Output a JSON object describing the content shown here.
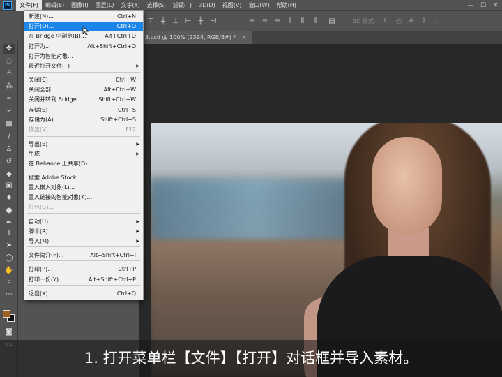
{
  "app": {
    "logo_text": "Ps"
  },
  "menubar": {
    "items": [
      "文件(F)",
      "编辑(E)",
      "图像(I)",
      "图层(L)",
      "文字(Y)",
      "选择(S)",
      "滤镜(T)",
      "3D(D)",
      "视图(V)",
      "窗口(W)",
      "帮助(H)"
    ],
    "active_index": 0,
    "window_controls": [
      "—",
      "☐",
      "✕"
    ]
  },
  "options_bar": {
    "mode_label": "3D 模式:"
  },
  "document": {
    "tab_title": "3.psd @ 100% (2394, RGB/8#) *",
    "close_glyph": "×"
  },
  "file_menu": {
    "items": [
      {
        "label": "新建(N)...",
        "shortcut": "Ctrl+N"
      },
      {
        "label": "打开(O)...",
        "shortcut": "Ctrl+O",
        "highlighted": true
      },
      {
        "label": "在 Bridge 中浏览(B)...",
        "shortcut": "Alt+Ctrl+O"
      },
      {
        "label": "打开为...",
        "shortcut": "Alt+Shift+Ctrl+O"
      },
      {
        "label": "打开为智能对象...",
        "shortcut": ""
      },
      {
        "label": "最近打开文件(T)",
        "shortcut": "",
        "submenu": true
      },
      {
        "label": "关闭(C)",
        "shortcut": "Ctrl+W"
      },
      {
        "label": "关闭全部",
        "shortcut": "Alt+Ctrl+W"
      },
      {
        "label": "关闭并转到 Bridge...",
        "shortcut": "Shift+Ctrl+W"
      },
      {
        "label": "存储(S)",
        "shortcut": "Ctrl+S"
      },
      {
        "label": "存储为(A)...",
        "shortcut": "Shift+Ctrl+S"
      },
      {
        "label": "恢复(V)",
        "shortcut": "F12",
        "disabled": true
      },
      {
        "label": "导出(E)",
        "shortcut": "",
        "submenu": true
      },
      {
        "label": "生成",
        "shortcut": "",
        "submenu": true
      },
      {
        "label": "在 Behance 上共享(D)...",
        "shortcut": ""
      },
      {
        "label": "搜索 Adobe Stock...",
        "shortcut": ""
      },
      {
        "label": "置入嵌入对象(L)...",
        "shortcut": ""
      },
      {
        "label": "置入链接的智能对象(K)...",
        "shortcut": ""
      },
      {
        "label": "打包(G)...",
        "shortcut": "",
        "disabled": true
      },
      {
        "label": "自动(U)",
        "shortcut": "",
        "submenu": true
      },
      {
        "label": "脚本(R)",
        "shortcut": "",
        "submenu": true
      },
      {
        "label": "导入(M)",
        "shortcut": "",
        "submenu": true
      },
      {
        "label": "文件简介(F)...",
        "shortcut": "Alt+Shift+Ctrl+I"
      },
      {
        "label": "打印(P)...",
        "shortcut": "Ctrl+P"
      },
      {
        "label": "打印一份(Y)",
        "shortcut": "Alt+Shift+Ctrl+P"
      },
      {
        "label": "退出(X)",
        "shortcut": "Ctrl+Q"
      }
    ]
  },
  "toolbar": {
    "icons": [
      "move-icon",
      "marquee-icon",
      "lasso-icon",
      "magic-wand-icon",
      "crop-icon",
      "eyedropper-icon",
      "healing-brush-icon",
      "brush-icon",
      "clone-stamp-icon",
      "history-brush-icon",
      "eraser-icon",
      "gradient-icon",
      "blur-icon",
      "dodge-icon",
      "pen-icon",
      "type-icon",
      "path-selection-icon",
      "ellipse-icon",
      "hand-icon",
      "zoom-icon",
      "more-icon"
    ],
    "foreground_color": "#a05f22",
    "background_color": "#111111"
  },
  "caption": {
    "text": "1. 打开菜单栏【文件】【打开】对话框并导入素材。"
  },
  "colors": {
    "highlight": "#1b86e8",
    "ui_background": "#535353",
    "menu_background": "#f0f0f0"
  }
}
